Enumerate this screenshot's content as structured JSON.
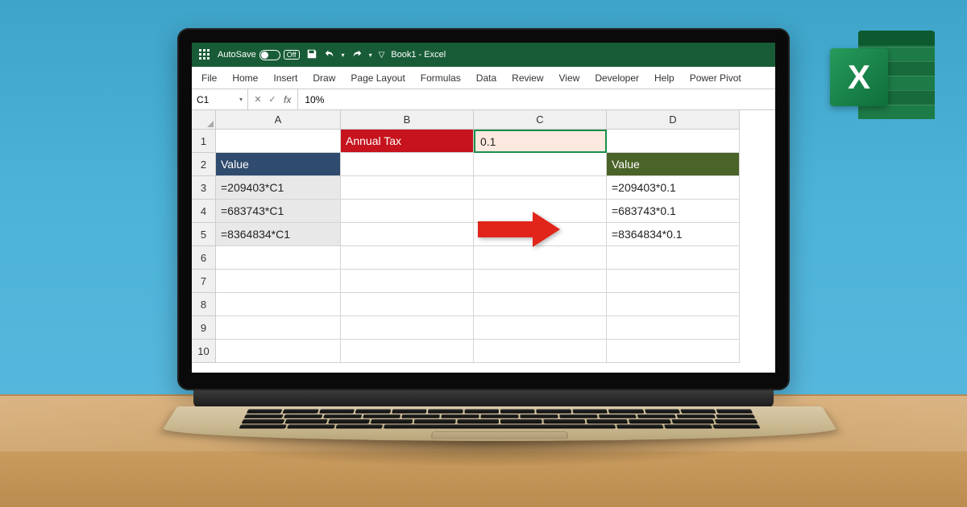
{
  "titlebar": {
    "autosave_label": "AutoSave",
    "autosave_state": "Off",
    "doc_title": "Book1 - Excel"
  },
  "ribbon": {
    "tabs": [
      "File",
      "Home",
      "Insert",
      "Draw",
      "Page Layout",
      "Formulas",
      "Data",
      "Review",
      "View",
      "Developer",
      "Help",
      "Power Pivot"
    ]
  },
  "formula_bar": {
    "name_box": "C1",
    "cancel": "✕",
    "enter": "✓",
    "fx": "fx",
    "value": "10%"
  },
  "columns": [
    "A",
    "B",
    "C",
    "D"
  ],
  "rows": [
    "1",
    "2",
    "3",
    "4",
    "5",
    "6",
    "7",
    "8",
    "9",
    "10"
  ],
  "cells": {
    "B1": "Annual Tax",
    "C1": "0.1",
    "A2": "Value",
    "D2": "Value",
    "A3": "=209403*C1",
    "A4": "=683743*C1",
    "A5": "=8364834*C1",
    "D3": "=209403*0.1",
    "D4": "=683743*0.1",
    "D5": "=8364834*0.1"
  },
  "logo": {
    "letter": "X"
  }
}
